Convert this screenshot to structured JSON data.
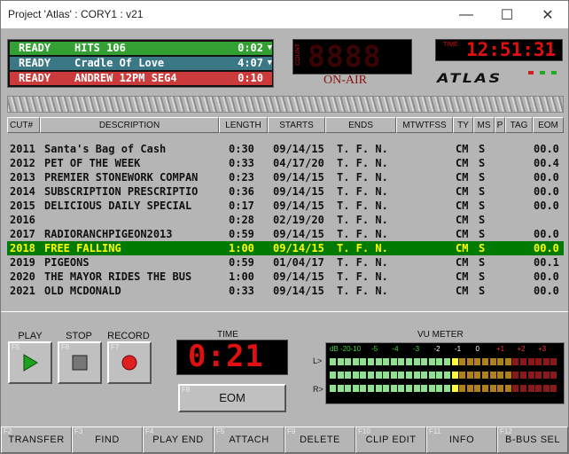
{
  "window": {
    "title": "Project 'Atlas' : CORY1 : v21",
    "minimize": "—",
    "maximize": "☐",
    "close": "✕"
  },
  "status_rows": [
    {
      "state": "READY",
      "title": "HITS 106",
      "time": "0:02",
      "arrow": "▼",
      "color": "#33a033"
    },
    {
      "state": "READY",
      "title": "Cradle Of Love",
      "time": "4:07",
      "arrow": "▼",
      "color": "#3a7886"
    },
    {
      "state": "READY",
      "title": "ANDREW 12PM SEG4",
      "time": "0:10",
      "arrow": "",
      "color": "#cc3b3b"
    }
  ],
  "count": {
    "label": "COUNT",
    "value": "8888"
  },
  "on_air": "ON-AIR",
  "clock": {
    "label": "TIME",
    "value": "12:51:31"
  },
  "logo": "ATLAS",
  "columns": [
    "CUT#",
    "DESCRIPTION",
    "LENGTH",
    "STARTS",
    "ENDS",
    "MTWTFSS",
    "TY",
    "MS",
    "P",
    "TAG",
    "EOM"
  ],
  "rows": [
    {
      "cut": "2011",
      "desc": "Santa's Bag of Cash",
      "length": "0:30",
      "starts": "09/14/15",
      "ends": "T. F. N.",
      "ty": "CM",
      "ms": "S",
      "eom": "00.0",
      "selected": false
    },
    {
      "cut": "2012",
      "desc": "PET OF THE WEEK",
      "length": "0:33",
      "starts": "04/17/20",
      "ends": "T. F. N.",
      "ty": "CM",
      "ms": "S",
      "eom": "00.4",
      "selected": false
    },
    {
      "cut": "2013",
      "desc": "PREMIER STONEWORK COMPAN",
      "length": "0:23",
      "starts": "09/14/15",
      "ends": "T. F. N.",
      "ty": "CM",
      "ms": "S",
      "eom": "00.0",
      "selected": false
    },
    {
      "cut": "2014",
      "desc": "SUBSCRIPTION PRESCRIPTIO",
      "length": "0:36",
      "starts": "09/14/15",
      "ends": "T. F. N.",
      "ty": "CM",
      "ms": "S",
      "eom": "00.0",
      "selected": false
    },
    {
      "cut": "2015",
      "desc": "DELICIOUS DAILY SPECIAL",
      "length": "0:17",
      "starts": "09/14/15",
      "ends": "T. F. N.",
      "ty": "CM",
      "ms": "S",
      "eom": "00.0",
      "selected": false
    },
    {
      "cut": "2016",
      "desc": "",
      "length": "0:28",
      "starts": "02/19/20",
      "ends": "T. F. N.",
      "ty": "CM",
      "ms": "S",
      "eom": "",
      "selected": false
    },
    {
      "cut": "2017",
      "desc": "RADIORANCHPIGEON2013",
      "length": "0:59",
      "starts": "09/14/15",
      "ends": "T. F. N.",
      "ty": "CM",
      "ms": "S",
      "eom": "00.0",
      "selected": false
    },
    {
      "cut": "2018",
      "desc": "FREE FALLING",
      "length": "1:00",
      "starts": "09/14/15",
      "ends": "T. F. N.",
      "ty": "CM",
      "ms": "S",
      "eom": "00.0",
      "selected": true
    },
    {
      "cut": "2019",
      "desc": "PIGEONS",
      "length": "0:59",
      "starts": "01/04/17",
      "ends": "T. F. N.",
      "ty": "CM",
      "ms": "S",
      "eom": "00.1",
      "selected": false
    },
    {
      "cut": "2020",
      "desc": "THE MAYOR RIDES THE BUS",
      "length": "1:00",
      "starts": "09/14/15",
      "ends": "T. F. N.",
      "ty": "CM",
      "ms": "S",
      "eom": "00.0",
      "selected": false
    },
    {
      "cut": "2021",
      "desc": "OLD MCDONALD",
      "length": "0:33",
      "starts": "09/14/15",
      "ends": "T. F. N.",
      "ty": "CM",
      "ms": "S",
      "eom": "00.0",
      "selected": false
    }
  ],
  "controls": {
    "play": {
      "label": "PLAY",
      "key": "F5"
    },
    "stop": {
      "label": "STOP",
      "key": "F6"
    },
    "record": {
      "label": "RECORD",
      "key": "F7"
    },
    "time_label": "TIME",
    "time_value": "0:21",
    "eom": {
      "label": "EOM",
      "key": "F8"
    }
  },
  "vu": {
    "title": "VU METER",
    "scale": [
      "dB -20",
      "-10",
      "-5",
      "-4",
      "-3",
      "-2",
      "-1",
      "0",
      "+1",
      "+2",
      "+3"
    ],
    "channels": [
      {
        "name": "L>",
        "level": 0.54
      },
      {
        "name": "",
        "level": 0.54
      },
      {
        "name": "R>",
        "level": 0.54
      }
    ]
  },
  "function_keys": [
    {
      "key": "F2",
      "label": "TRANSFER"
    },
    {
      "key": "F3",
      "label": "FIND"
    },
    {
      "key": "F4",
      "label": "PLAY END"
    },
    {
      "key": "F5",
      "label": "ATTACH"
    },
    {
      "key": "F9",
      "label": "DELETE"
    },
    {
      "key": "F10",
      "label": "CLIP EDIT"
    },
    {
      "key": "F11",
      "label": "INFO"
    },
    {
      "key": "F12",
      "label": "B-BUS SEL"
    }
  ]
}
